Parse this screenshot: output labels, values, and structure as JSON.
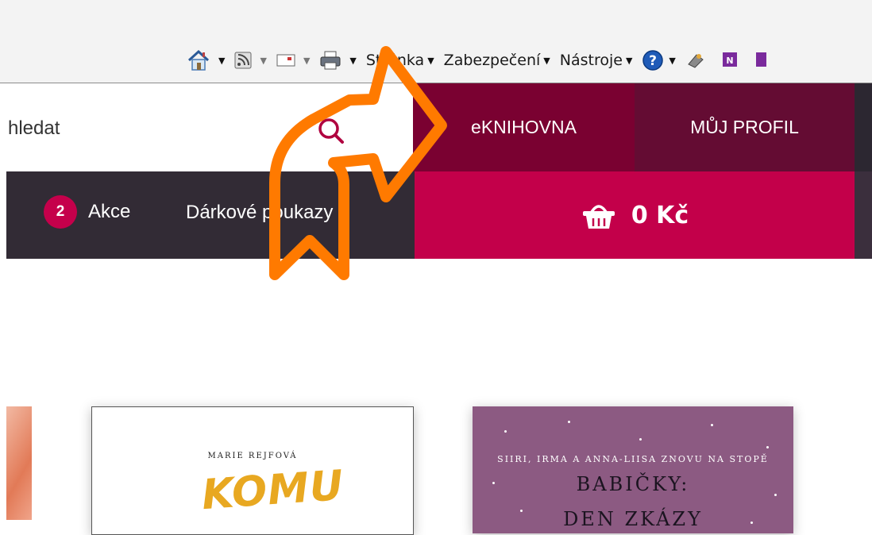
{
  "browser_toolbar": {
    "icons": [
      "home-icon",
      "feeds-icon",
      "mail-icon",
      "print-icon"
    ],
    "menus": [
      {
        "label": "Stránka"
      },
      {
        "label": "Zabezpečení"
      },
      {
        "label": "Nástroje"
      }
    ],
    "extra_icons": [
      "help-icon",
      "addon-icon",
      "onenote-icon"
    ]
  },
  "search": {
    "placeholder": "hledat"
  },
  "top_nav": {
    "eknihovna": "eKNIHOVNA",
    "profile": "MŮJ PROFIL"
  },
  "sub_nav": {
    "akce_count": "2",
    "akce_label": "Akce",
    "gift_label": "Dárkové poukazy"
  },
  "cart": {
    "total": "0 Kč"
  },
  "books": [
    {
      "author": "MARIE REJFOVÁ",
      "title": "KOMU"
    },
    {
      "subtitle": "SIIRI, IRMA A ANNA-LIISA ZNOVU NA STOPĚ",
      "title_line1": "BABIČKY:",
      "title_line2": "DEN ZKÁZY"
    }
  ],
  "colors": {
    "eknihovna_bg": "#7a0131",
    "profile_bg": "#640c33",
    "dark_bar": "#322b35",
    "cart_bg": "#c3004a",
    "badge_bg": "#c5004b",
    "annotation_arrow": "#ff7a00"
  }
}
